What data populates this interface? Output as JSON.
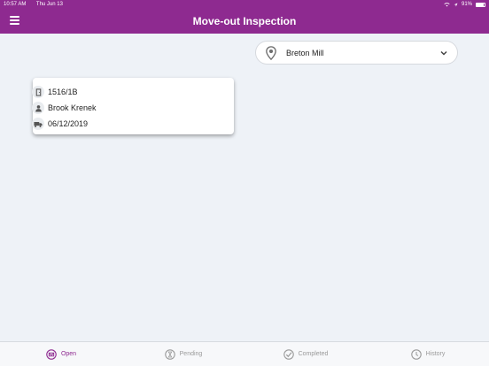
{
  "status_bar": {
    "time": "10:57 AM",
    "date": "Thu Jun 13",
    "battery": "91%"
  },
  "header": {
    "title": "Move-out Inspection",
    "menu_icon": "hamburger-icon"
  },
  "location": {
    "value": "Breton Mill",
    "icon": "location-pin-icon",
    "dropdown_icon": "chevron-down-icon"
  },
  "inspection_card": {
    "unit": "1516/1B",
    "resident": "Brook Krenek",
    "date": "06/12/2019",
    "icons": [
      "door-icon",
      "person-icon",
      "moving-truck-icon"
    ]
  },
  "tabs": [
    {
      "label": "Open",
      "icon": "open-icon",
      "active": true
    },
    {
      "label": "Pending",
      "icon": "pending-icon",
      "active": false
    },
    {
      "label": "Completed",
      "icon": "check-icon",
      "active": false
    },
    {
      "label": "History",
      "icon": "history-icon",
      "active": false
    }
  ],
  "colors": {
    "brand": "#8e2a90",
    "background": "#eef2f7",
    "inactive_tab": "#9a9a9a"
  }
}
